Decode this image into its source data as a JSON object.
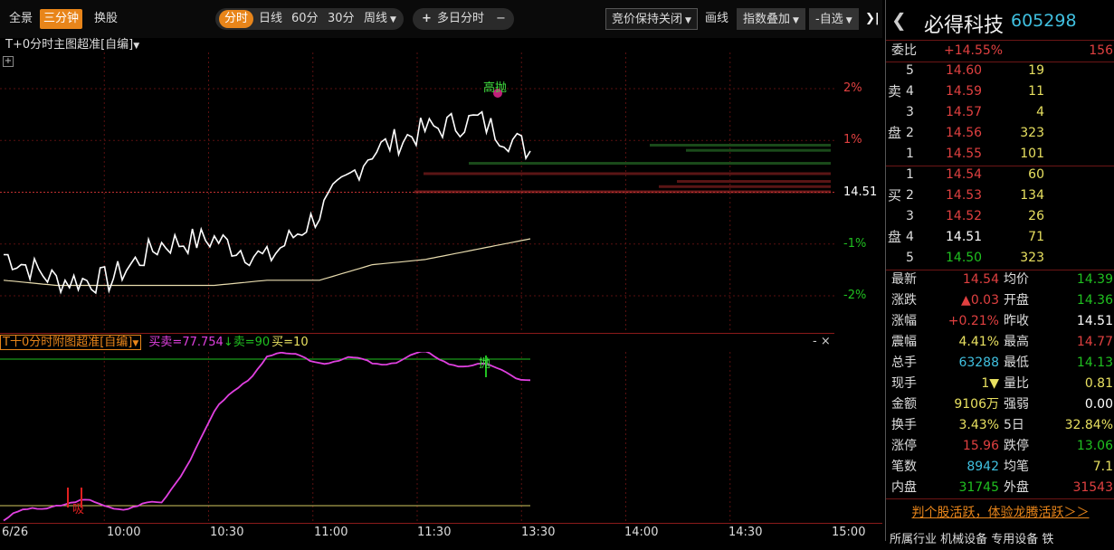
{
  "toolbar": {
    "left_tabs": [
      "全景",
      "三分钟",
      "换股"
    ],
    "period_tabs": [
      "分时",
      "日线",
      "60分",
      "30分",
      "周线"
    ],
    "multi_day": "多日分时",
    "plus": "+",
    "minus": "−",
    "auction": "竞价保持关闭",
    "draw": "画线",
    "index_overlay": "指数叠加",
    "self_select": "自选",
    "collapse": "❯|"
  },
  "main_chart": {
    "title": "T+0分时主图超准[自编]",
    "expand": "+",
    "annotation": "高抛",
    "price_labels": [
      {
        "text": "2%",
        "pct": 2.0,
        "color": "#e04040"
      },
      {
        "text": "1%",
        "pct": 1.0,
        "color": "#e04040"
      },
      {
        "text": "14.51",
        "pct": 0.0,
        "color": "#ffffff"
      },
      {
        "text": "-1%",
        "pct": -1.0,
        "color": "#20c020"
      },
      {
        "text": "-2%",
        "pct": -2.0,
        "color": "#20c020"
      }
    ]
  },
  "sub_chart": {
    "title": "T十0分时附图超准[自编]",
    "ind1": "买卖=77.754",
    "ind1_arrow": "↓",
    "ind2": "卖=90",
    "ind3": "买=10",
    "annotation_top": "抛",
    "annotation_bottom": "吸",
    "controls": "- ×"
  },
  "time_axis": [
    "6/26",
    "10:00",
    "10:30",
    "11:00",
    "11:30",
    "13:30",
    "14:00",
    "14:30",
    "15:00"
  ],
  "chart_data": [
    {
      "type": "line",
      "title": "",
      "ylabel": "",
      "ylim_pct": [
        -2.7,
        2.7
      ],
      "base_price": 14.51,
      "x": [
        "9:30",
        "9:45",
        "10:00",
        "10:15",
        "10:30",
        "10:45",
        "11:00",
        "11:15",
        "11:30",
        "11:45",
        "13:00"
      ],
      "series": [
        {
          "name": "price_pct",
          "color": "#ffffff",
          "values": [
            -1.2,
            -1.7,
            -1.7,
            -1.0,
            -0.9,
            -1.3,
            -0.4,
            0.8,
            1.2,
            1.4,
            0.8
          ]
        },
        {
          "name": "avg_pct",
          "color": "#e8dcae",
          "values": [
            -1.7,
            -1.8,
            -1.8,
            -1.8,
            -1.8,
            -1.7,
            -1.7,
            -1.4,
            -1.3,
            -1.1,
            -0.9
          ]
        }
      ]
    },
    {
      "type": "line",
      "title": "",
      "ylim": [
        0,
        100
      ],
      "series": [
        {
          "name": "买卖",
          "color": "#e040e0",
          "values": [
            2,
            12,
            10,
            10,
            60,
            92,
            90,
            88,
            92,
            86,
            80
          ]
        }
      ],
      "ref_lines": [
        {
          "name": "卖",
          "value": 90,
          "color": "#20c020"
        },
        {
          "name": "买",
          "value": 10,
          "color": "#d4c860"
        }
      ]
    }
  ],
  "panel": {
    "name": "必得科技",
    "code": "605298",
    "nav_prev": "❮",
    "wei_label": "委比",
    "wei_value": "+14.55%",
    "wei_diff": "156",
    "sell_side": "卖盘",
    "buy_side": "买盘",
    "sells": [
      {
        "level": "5",
        "price": "14.60",
        "vol": "19"
      },
      {
        "level": "4",
        "price": "14.59",
        "vol": "11"
      },
      {
        "level": "3",
        "price": "14.57",
        "vol": "4"
      },
      {
        "level": "2",
        "price": "14.56",
        "vol": "323"
      },
      {
        "level": "1",
        "price": "14.55",
        "vol": "101"
      }
    ],
    "buys": [
      {
        "level": "1",
        "price": "14.54",
        "vol": "60"
      },
      {
        "level": "2",
        "price": "14.53",
        "vol": "134"
      },
      {
        "level": "3",
        "price": "14.52",
        "vol": "26"
      },
      {
        "level": "4",
        "price": "14.51",
        "vol": "71"
      },
      {
        "level": "5",
        "price": "14.50",
        "vol": "323"
      }
    ],
    "stats": [
      {
        "l1": "最新",
        "v1": "14.54",
        "c1": "#e04040",
        "l2": "均价",
        "v2": "14.39",
        "c2": "#20c020"
      },
      {
        "l1": "涨跌",
        "v1": "▲0.03",
        "c1": "#e04040",
        "l2": "开盘",
        "v2": "14.36",
        "c2": "#20c020"
      },
      {
        "l1": "涨幅",
        "v1": "+0.21%",
        "c1": "#e04040",
        "l2": "昨收",
        "v2": "14.51",
        "c2": "#ffffff"
      },
      {
        "l1": "震幅",
        "v1": "4.41%",
        "c1": "#e8e060",
        "l2": "最高",
        "v2": "14.77",
        "c2": "#e04040"
      },
      {
        "l1": "总手",
        "v1": "63288",
        "c1": "#40c0e0",
        "l2": "最低",
        "v2": "14.13",
        "c2": "#20c020"
      },
      {
        "l1": "现手",
        "v1": "1▼",
        "c1": "#e8e060",
        "l2": "量比",
        "v2": "0.81",
        "c2": "#e8e060"
      },
      {
        "l1": "金额",
        "v1": "9106万",
        "c1": "#e8e060",
        "l2": "强弱",
        "v2": "0.00",
        "c2": "#ffffff"
      },
      {
        "l1": "换手",
        "v1": "3.43%",
        "c1": "#e8e060",
        "l2": "5日",
        "v2": "32.84%",
        "c2": "#e8e060"
      },
      {
        "l1": "涨停",
        "v1": "15.96",
        "c1": "#e04040",
        "l2": "跌停",
        "v2": "13.06",
        "c2": "#20c020"
      },
      {
        "l1": "笔数",
        "v1": "8942",
        "c1": "#40c0e0",
        "l2": "均笔",
        "v2": "7.1",
        "c2": "#e8e060"
      },
      {
        "l1": "内盘",
        "v1": "31745",
        "c1": "#20c020",
        "l2": "外盘",
        "v2": "31543",
        "c2": "#e04040"
      }
    ],
    "promo": "判个股活跃，体验龙腾活跃＞＞",
    "industry_partial": "所属行业  机械设备  专用设备  铁"
  }
}
